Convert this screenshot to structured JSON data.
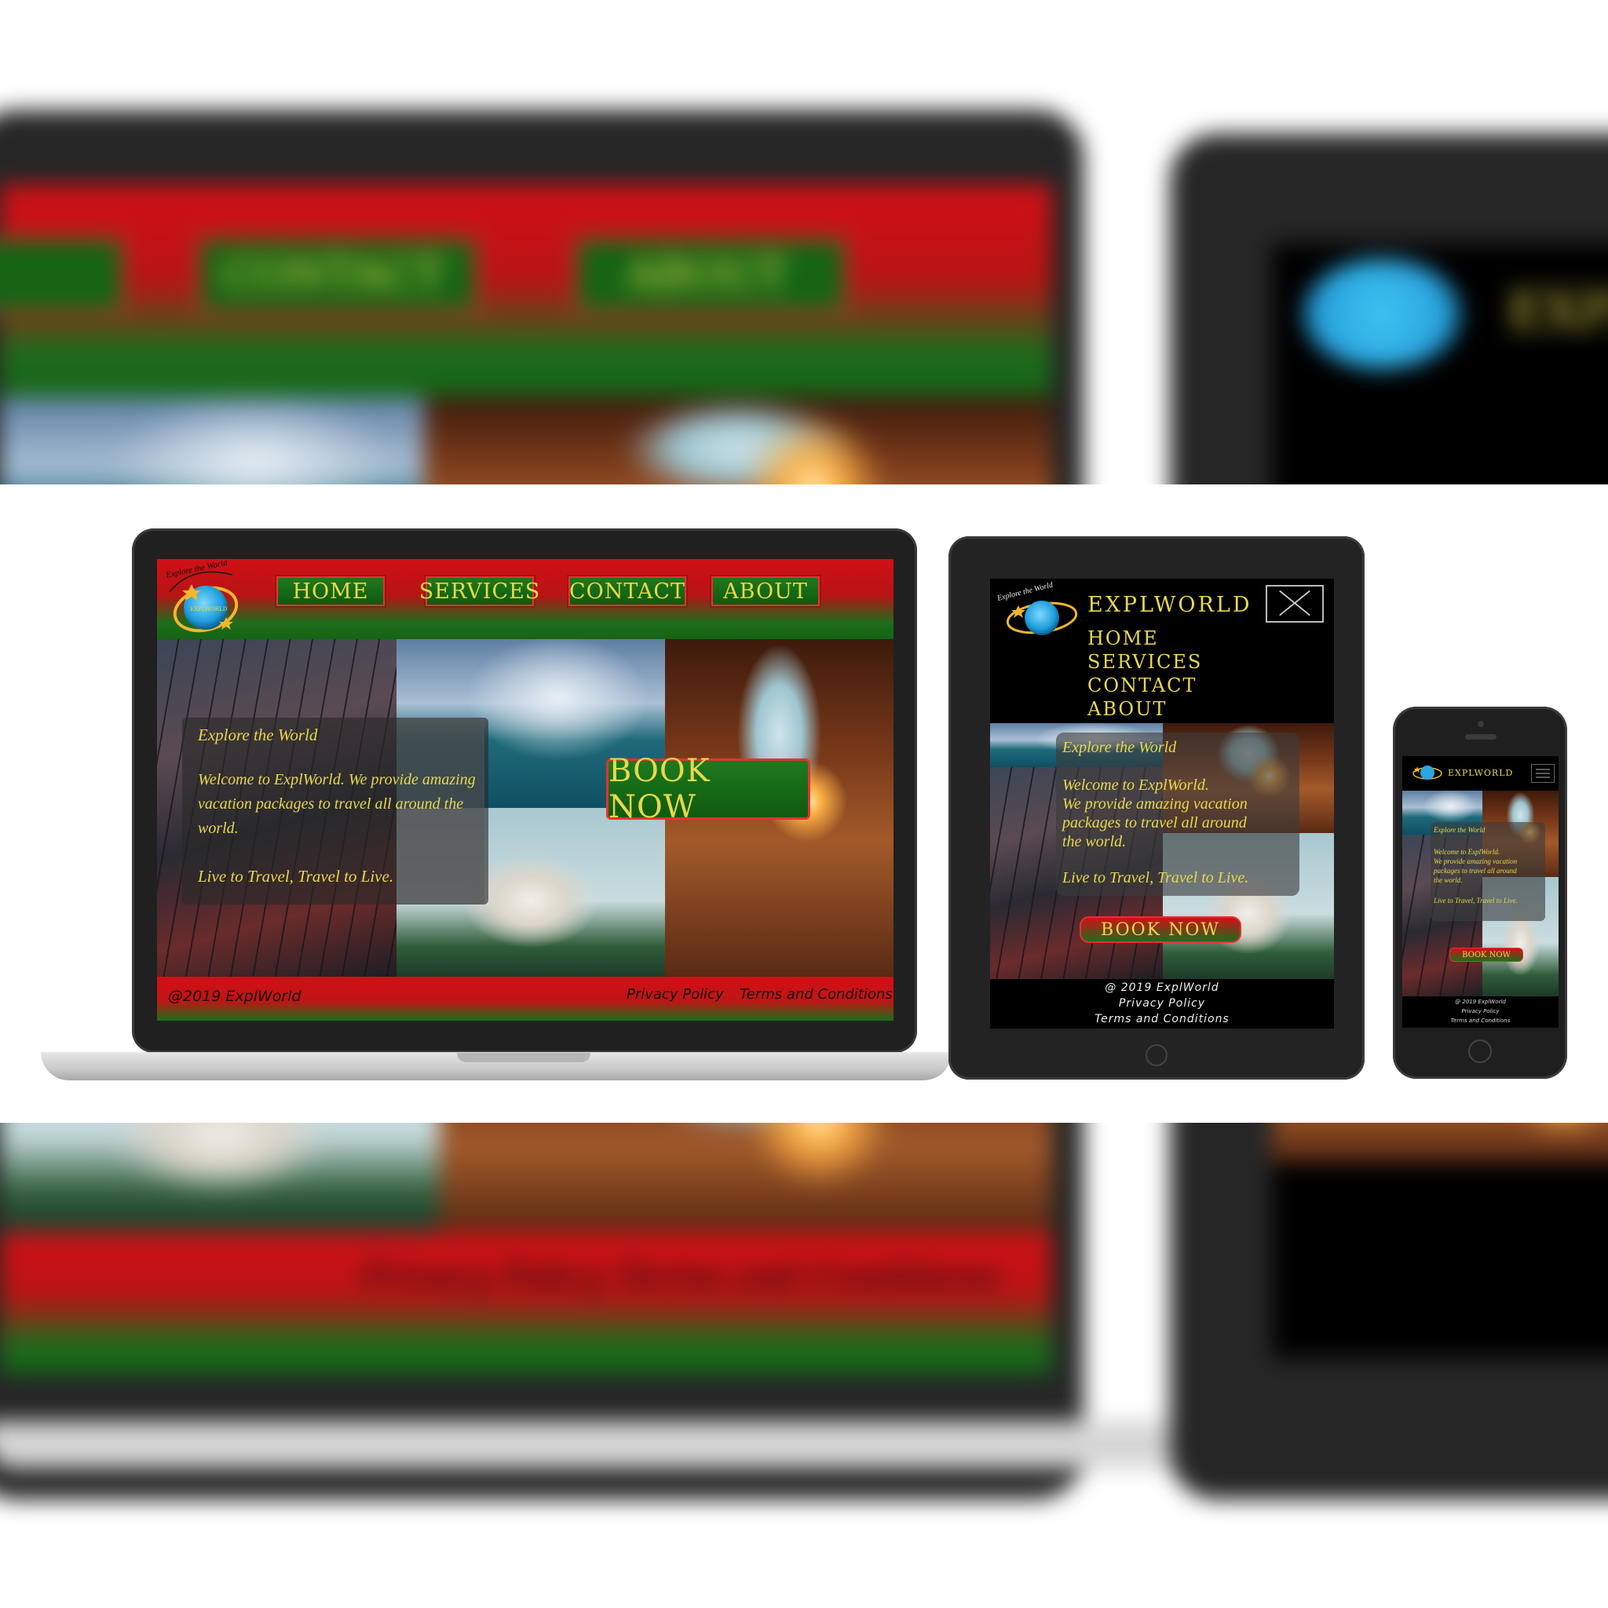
{
  "site": {
    "logo_tagline": "Explore the World",
    "brand": "EXPLWORLD",
    "brand_mixed": "EXPLWORLD"
  },
  "laptop": {
    "nav": [
      "HOME",
      "SERVICES",
      "CONTACT",
      "ABOUT"
    ],
    "hero_title": "Explore the World",
    "hero_line1": "Welcome to ExplWorld. We provide amazing",
    "hero_line2": "vacation packages to travel all around the",
    "hero_line3": "world.",
    "hero_tagline": "Live to Travel, Travel to Live.",
    "cta": "BOOK NOW",
    "footer_copyright": "@2019 ExplWorld",
    "footer_privacy": "Privacy Policy",
    "footer_terms": "Terms and Conditions"
  },
  "tablet": {
    "menu": [
      "HOME",
      "SERVICES",
      "CONTACT",
      "ABOUT"
    ],
    "hero_title": "Explore the World",
    "hero_line1": "Welcome to ExplWorld.",
    "hero_line2": "We provide amazing vacation",
    "hero_line3": "packages to travel all around",
    "hero_line4": "the world.",
    "hero_tagline": "Live to Travel, Travel to Live.",
    "cta": "BOOK NOW",
    "footer_copyright": "@ 2019 ExplWorld",
    "footer_privacy": "Privacy Policy",
    "footer_terms": "Terms and Conditions"
  },
  "phone": {
    "brand": "EXPLWORLD",
    "hero_title": "Explore the World",
    "hero_line1": "Welcome to ExplWorld.",
    "hero_line2": "We provide amazing vacation",
    "hero_line3": "packages to travel all around",
    "hero_line4": "the world.",
    "hero_tagline": "Live to Travel, Travel to Live.",
    "cta": "BOOK NOW",
    "footer_copyright": "@ 2019 ExplWorld",
    "footer_privacy": "Privacy Policy",
    "footer_terms": "Terms and Conditions"
  },
  "background": {
    "top_nav": [
      "CONTACT",
      "ABOUT"
    ],
    "tablet_brand": "EXPLWORLD",
    "footer_links": "Privacy Policy   Terms and Conditions"
  },
  "colors": {
    "red": "#d11016",
    "green": "#146414",
    "gold_text": "#e8d84a",
    "device_bezel": "#202020"
  },
  "icons": {
    "logo": "globe-logo-icon",
    "menu_close": "close-icon",
    "menu_open": "hamburger-icon",
    "home_button": "home-button-icon"
  }
}
